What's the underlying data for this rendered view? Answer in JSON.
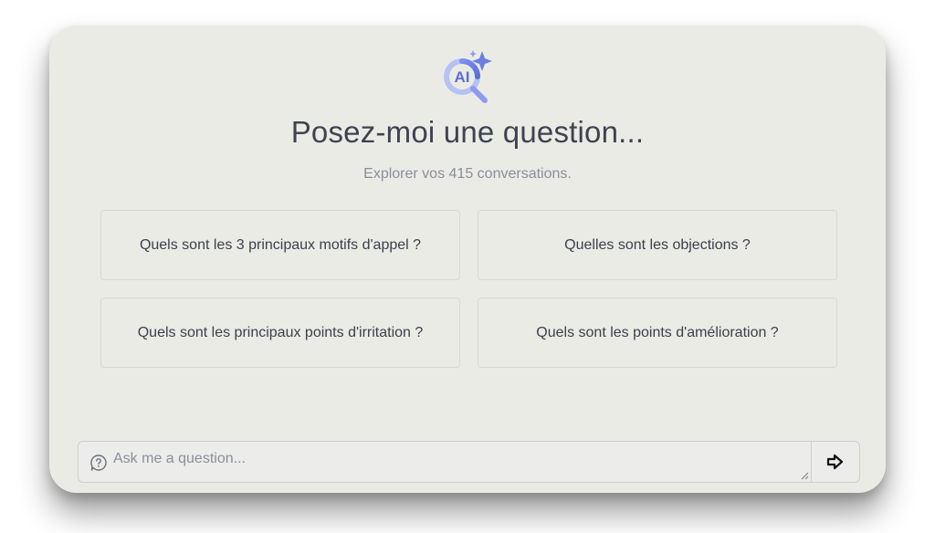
{
  "header": {
    "logo_icon": "ai-search-sparkle-icon",
    "logo_text": "AI",
    "title": "Posez-moi une question...",
    "subtitle": "Explorer vos 415 conversations."
  },
  "suggestions": [
    {
      "label": "Quels sont les 3 principaux motifs d'appel ?"
    },
    {
      "label": "Quelles sont les objections ?"
    },
    {
      "label": "Quels sont les principaux points d'irritation ?"
    },
    {
      "label": "Quels sont les points d'amélioration ?"
    }
  ],
  "chat_input": {
    "placeholder": "Ask me a question...",
    "value": "",
    "icon": "question-bubble-icon"
  },
  "send_button": {
    "icon": "arrow-right-icon"
  },
  "colors": {
    "card_background": "#ebebe6",
    "logo_accent": "#6b7fe0",
    "text_primary": "#3f4350",
    "text_muted": "#8b8e9a"
  }
}
